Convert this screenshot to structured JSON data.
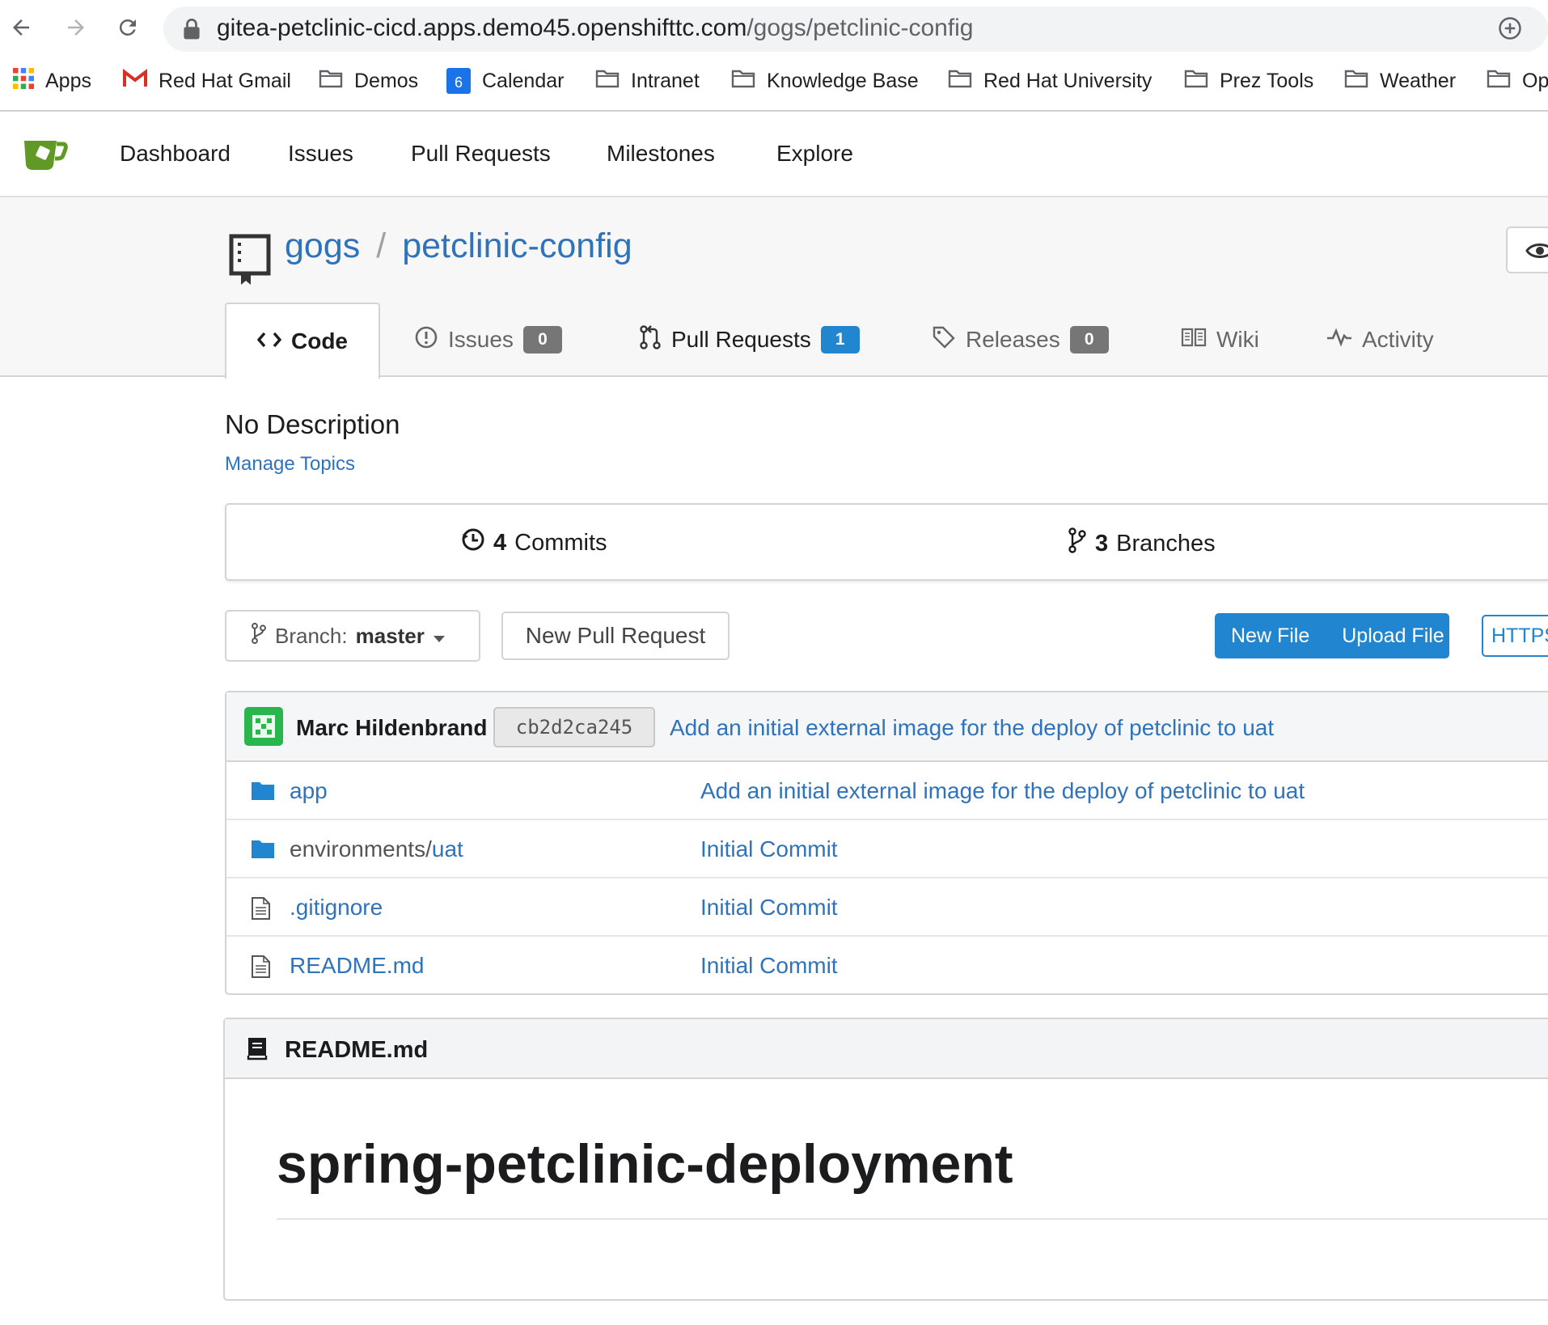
{
  "browser": {
    "url_host": "gitea-petclinic-cicd.apps.demo45.openshifttc.com",
    "url_path": "/gogs/petclinic-config",
    "bookmarks": [
      {
        "label": "Apps",
        "icon": "apps-grid-icon"
      },
      {
        "label": "Red Hat Gmail",
        "icon": "gmail-icon"
      },
      {
        "label": "Demos",
        "icon": "folder-icon"
      },
      {
        "label": "Calendar",
        "icon": "calendar-icon"
      },
      {
        "label": "Intranet",
        "icon": "folder-icon"
      },
      {
        "label": "Knowledge Base",
        "icon": "folder-icon"
      },
      {
        "label": "Red Hat University",
        "icon": "folder-icon"
      },
      {
        "label": "Prez Tools",
        "icon": "folder-icon"
      },
      {
        "label": "Weather",
        "icon": "folder-icon"
      },
      {
        "label": "Op",
        "icon": "folder-icon"
      }
    ],
    "calendar_day": "6"
  },
  "nav": {
    "items": [
      "Dashboard",
      "Issues",
      "Pull Requests",
      "Milestones",
      "Explore"
    ]
  },
  "repo": {
    "owner": "gogs",
    "separator": "/",
    "name": "petclinic-config",
    "tabs": [
      {
        "label": "Code",
        "count": null
      },
      {
        "label": "Issues",
        "count": "0"
      },
      {
        "label": "Pull Requests",
        "count": "1"
      },
      {
        "label": "Releases",
        "count": "0"
      },
      {
        "label": "Wiki",
        "count": null
      },
      {
        "label": "Activity",
        "count": null
      }
    ],
    "description": "No Description",
    "manage_topics": "Manage Topics"
  },
  "stats": {
    "commits_count": "4",
    "commits_label": "Commits",
    "branches_count": "3",
    "branches_label": "Branches"
  },
  "toolbar": {
    "branch_prefix": "Branch:",
    "branch_name": "master",
    "new_pull_request": "New Pull Request",
    "new_file": "New File",
    "upload_file": "Upload File",
    "clone_protocol": "HTTPS"
  },
  "latest_commit": {
    "author": "Marc Hildenbrand",
    "sha": "cb2d2ca245",
    "message": "Add an initial external image for the deploy of petclinic to uat"
  },
  "files": [
    {
      "type": "folder",
      "prefix": "",
      "name": "app",
      "message": "Add an initial external image for the deploy of petclinic to uat"
    },
    {
      "type": "folder",
      "prefix": "environments/",
      "name": "uat",
      "message": "Initial Commit"
    },
    {
      "type": "file",
      "prefix": "",
      "name": ".gitignore",
      "message": "Initial Commit"
    },
    {
      "type": "file",
      "prefix": "",
      "name": "README.md",
      "message": "Initial Commit"
    }
  ],
  "readme": {
    "filename": "README.md",
    "heading": "spring-petclinic-deployment"
  },
  "colors": {
    "link": "#2f73bb",
    "primary_button": "#2185d0",
    "badge_grey": "#767676",
    "badge_blue": "#2185d0",
    "gitea_green": "#609926"
  }
}
